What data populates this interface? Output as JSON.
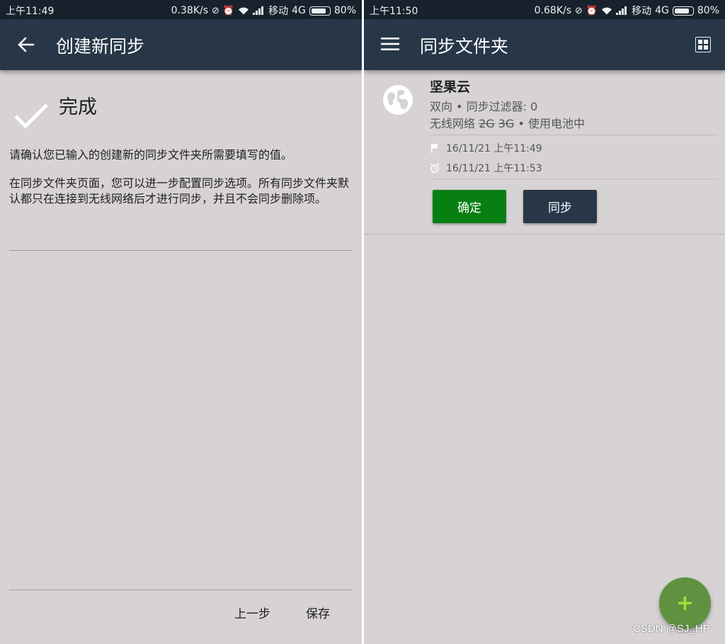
{
  "left": {
    "status": {
      "time": "上午11:49",
      "speed": "0.38K/s",
      "carrier": "移动",
      "network": "4G",
      "battery": "80%"
    },
    "appbar": {
      "title": "创建新同步"
    },
    "done_title": "完成",
    "para1": "请确认您已输入的创建新的同步文件夹所需要填写的值。",
    "para2": "在同步文件夹页面，您可以进一步配置同步选项。所有同步文件夹默认都只在连接到无线网络后才进行同步，并且不会同步删除项。",
    "buttons": {
      "prev": "上一步",
      "save": "保存"
    }
  },
  "right": {
    "status": {
      "time": "上午11:50",
      "speed": "0.68K/s",
      "carrier": "移动",
      "network": "4G",
      "battery": "80%"
    },
    "appbar": {
      "title": "同步文件夹"
    },
    "folder": {
      "name": "坚果云",
      "direction": "双向",
      "filter": "同步过滤器: 0",
      "wifi": "无线网络",
      "g2": "2G",
      "g3": "3G",
      "battery": "使用电池中",
      "created": "16/11/21 上午11:49",
      "scheduled": "16/11/21 上午11:53",
      "separator": " • "
    },
    "buttons": {
      "ok": "确定",
      "sync": "同步"
    },
    "fab": "+"
  },
  "watermark": "CSDN @SJ_HP",
  "colors": {
    "appbar": "#273748",
    "statusbar": "#17222d",
    "ok_button": "#087f12",
    "fab": "#5f9140",
    "background": "#d7d3d4"
  }
}
